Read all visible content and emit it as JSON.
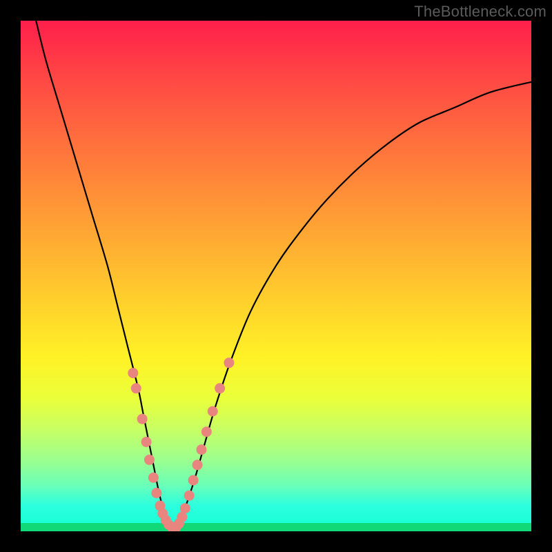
{
  "watermark": "TheBottleneck.com",
  "colors": {
    "frame_bg": "#000000",
    "curve_stroke": "#000000",
    "marker_fill": "#e9857f",
    "marker_stroke": "#b85a53",
    "green_band": "#12d977"
  },
  "chart_data": {
    "type": "line",
    "title": "",
    "xlabel": "",
    "ylabel": "",
    "xlim": [
      0,
      100
    ],
    "ylim": [
      0,
      100
    ],
    "grid": false,
    "series": [
      {
        "name": "bottleneck-curve",
        "x": [
          3,
          5,
          8,
          11,
          14,
          17,
          19,
          21,
          23,
          24,
          25,
          26,
          27,
          28,
          29,
          30,
          31,
          32,
          34,
          36,
          38,
          41,
          45,
          50,
          55,
          60,
          66,
          72,
          78,
          85,
          92,
          100
        ],
        "y": [
          100,
          92,
          82,
          72,
          62,
          52,
          44,
          36,
          28,
          23,
          18,
          13,
          8,
          4,
          1.5,
          0.5,
          1.5,
          4,
          10,
          17,
          24,
          33,
          43,
          52,
          59,
          65,
          71,
          76,
          80,
          83,
          86,
          88
        ]
      }
    ],
    "markers": [
      {
        "x": 22.0,
        "y": 31
      },
      {
        "x": 22.6,
        "y": 28
      },
      {
        "x": 23.8,
        "y": 22
      },
      {
        "x": 24.6,
        "y": 17.5
      },
      {
        "x": 25.2,
        "y": 14
      },
      {
        "x": 26.0,
        "y": 10.5
      },
      {
        "x": 26.6,
        "y": 7.5
      },
      {
        "x": 27.3,
        "y": 5
      },
      {
        "x": 27.8,
        "y": 3.5
      },
      {
        "x": 28.4,
        "y": 2.2
      },
      {
        "x": 29.0,
        "y": 1.3
      },
      {
        "x": 29.6,
        "y": 0.8
      },
      {
        "x": 30.4,
        "y": 0.8
      },
      {
        "x": 31.0,
        "y": 1.5
      },
      {
        "x": 31.6,
        "y": 2.8
      },
      {
        "x": 32.2,
        "y": 4.5
      },
      {
        "x": 33.0,
        "y": 7
      },
      {
        "x": 33.8,
        "y": 10
      },
      {
        "x": 34.6,
        "y": 13
      },
      {
        "x": 35.4,
        "y": 16
      },
      {
        "x": 36.4,
        "y": 19.5
      },
      {
        "x": 37.6,
        "y": 23.5
      },
      {
        "x": 39.0,
        "y": 28
      },
      {
        "x": 40.8,
        "y": 33
      }
    ]
  }
}
